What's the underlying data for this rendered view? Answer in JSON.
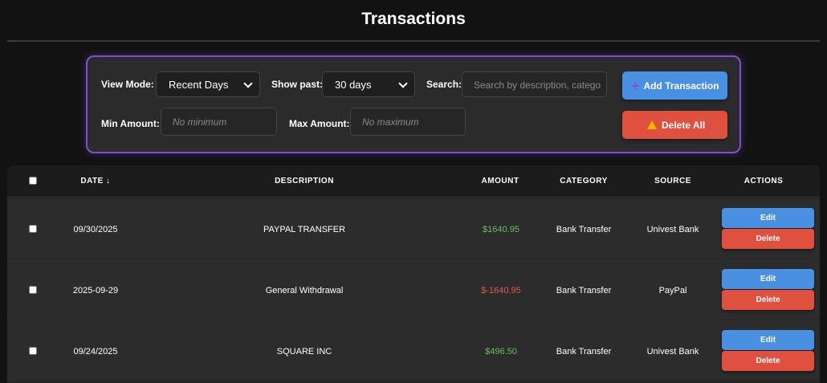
{
  "page": {
    "title": "Transactions"
  },
  "filters": {
    "view_mode_label": "View Mode:",
    "view_mode_value": "Recent Days",
    "show_past_label": "Show past:",
    "show_past_value": "30 days",
    "search_label": "Search:",
    "search_placeholder": "Search by description, catego",
    "min_amount_label": "Min Amount:",
    "min_amount_placeholder": "No minimum",
    "max_amount_label": "Max Amount:",
    "max_amount_placeholder": "No maximum",
    "add_button_label": "Add Transaction",
    "delete_all_label": "Delete All"
  },
  "table": {
    "headers": {
      "date": "DATE ↓",
      "description": "DESCRIPTION",
      "amount": "AMOUNT",
      "category": "CATEGORY",
      "source": "SOURCE",
      "actions": "ACTIONS"
    },
    "edit_label": "Edit",
    "delete_label": "Delete",
    "rows": [
      {
        "date": "09/30/2025",
        "description": "PAYPAL TRANSFER",
        "amount": "$1640.95",
        "category": "Bank Transfer",
        "source": "Univest Bank"
      },
      {
        "date": "2025-09-29",
        "description": "General Withdrawal",
        "amount": "$-1640.95",
        "category": "Bank Transfer",
        "source": "PayPal"
      },
      {
        "date": "09/24/2025",
        "description": "SQUARE INC",
        "amount": "$496.50",
        "category": "Bank Transfer",
        "source": "Univest Bank"
      }
    ]
  },
  "colors": {
    "accent_border": "#7e4fd6",
    "primary_button": "#4a90e2",
    "danger_button": "#e0503f",
    "positive_amount": "#6bbf59",
    "negative_amount": "#e05a4f"
  }
}
